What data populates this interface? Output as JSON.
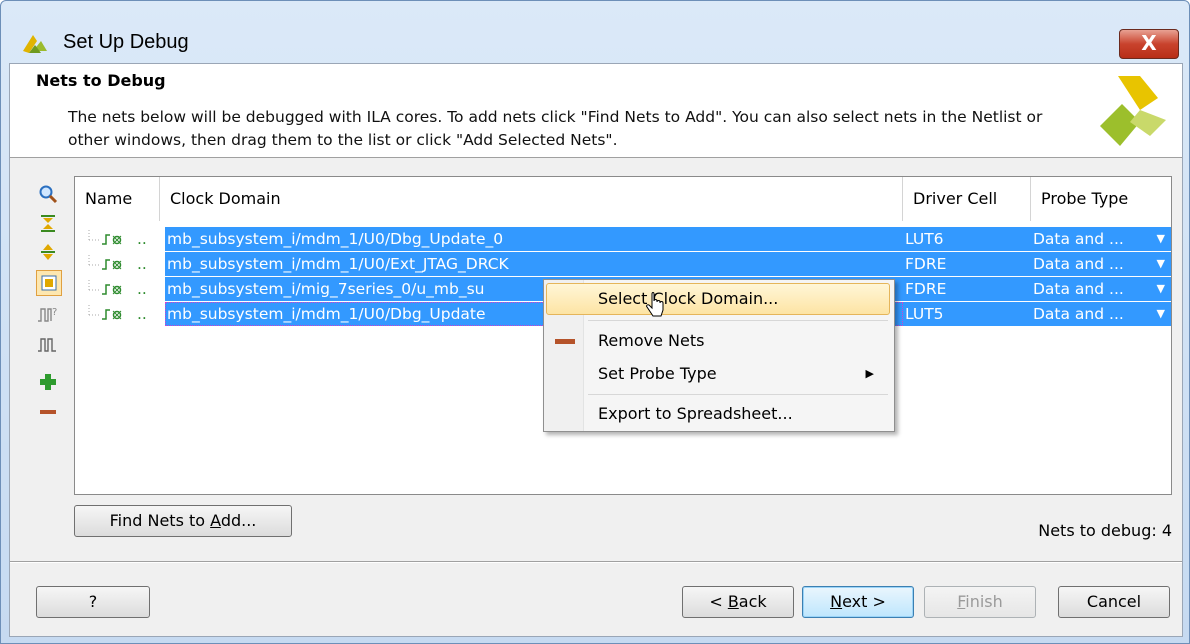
{
  "window": {
    "title": "Set Up Debug",
    "close_label": "X"
  },
  "header": {
    "title": "Nets to Debug",
    "description": "The nets below will be debugged with ILA cores. To add nets click \"Find Nets to Add\". You can also select nets in the Netlist or other windows, then drag them to the list or click \"Add Selected Nets\"."
  },
  "toolbar_icons": [
    "search-icon",
    "collapse-all-icon",
    "expand-all-icon",
    "select-icon",
    "probe-icon",
    "waveform-icon",
    "add-icon",
    "remove-icon"
  ],
  "table": {
    "columns": [
      "Name",
      "Clock Domain",
      "Driver Cell",
      "Probe Type"
    ],
    "rows": [
      {
        "name": "..",
        "clock_domain": "mb_subsystem_i/mdm_1/U0/Dbg_Update_0",
        "driver_cell": "LUT6",
        "probe_type": "Data and ..."
      },
      {
        "name": "..",
        "clock_domain": "mb_subsystem_i/mdm_1/U0/Ext_JTAG_DRCK",
        "driver_cell": "FDRE",
        "probe_type": "Data and ..."
      },
      {
        "name": "..",
        "clock_domain": "mb_subsystem_i/mig_7series_0/u_mb_su",
        "driver_cell": "FDRE",
        "probe_type": "Data and ..."
      },
      {
        "name": "..",
        "clock_domain": "mb_subsystem_i/mdm_1/U0/Dbg_Update",
        "driver_cell": "LUT5",
        "probe_type": "Data and ..."
      }
    ]
  },
  "context_menu": {
    "items": [
      "Select Clock Domain...",
      "Remove Nets",
      "Set Probe Type",
      "Export to Spreadsheet..."
    ]
  },
  "find_nets_button": {
    "prefix": "Find Nets to ",
    "mnemonic": "A",
    "suffix": "dd..."
  },
  "status": "Nets to debug: 4",
  "footer": {
    "help": "?",
    "back": {
      "prefix": "< ",
      "mnemonic": "B",
      "suffix": "ack"
    },
    "next": {
      "mnemonic": "N",
      "suffix": "ext >"
    },
    "finish": {
      "mnemonic": "F",
      "suffix": "inish"
    },
    "cancel": "Cancel"
  },
  "colors": {
    "selection": "#3399ff",
    "menu_highlight": "#fde4a4",
    "remove": "#b5532a",
    "add": "#2e9b2e"
  }
}
